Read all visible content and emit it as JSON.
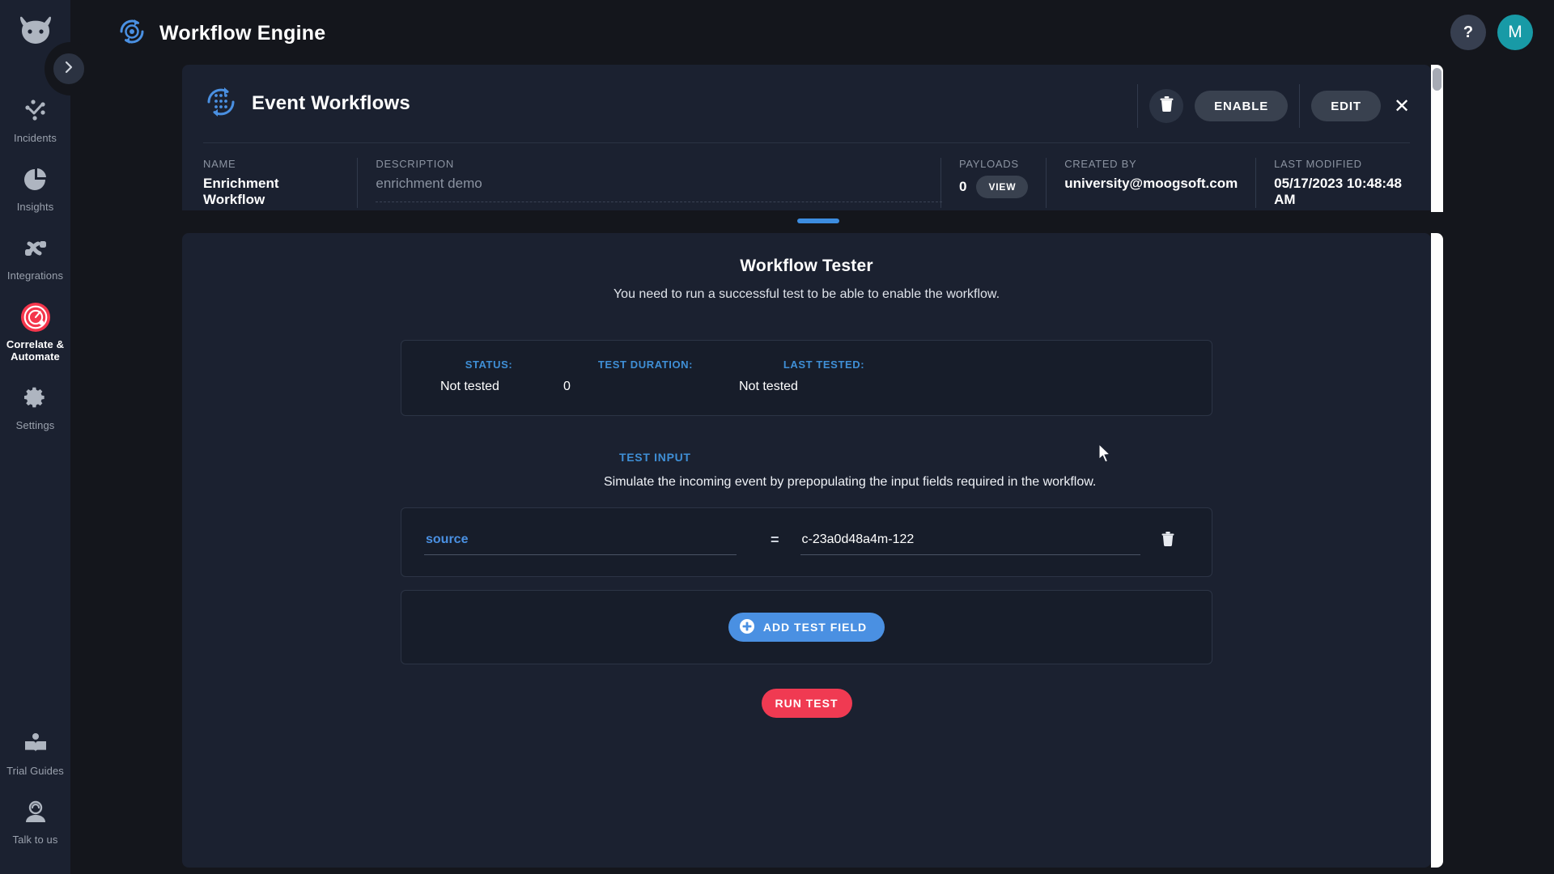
{
  "app": {
    "title": "Workflow Engine",
    "logo_icon": "workflow-engine-icon",
    "help_label": "?",
    "avatar_label": "M"
  },
  "sidebar": {
    "brand_icon": "moogsoft-bull-logo",
    "expand_icon": "chevron-right-icon",
    "items": [
      {
        "label": "Incidents",
        "icon": "incidents-icon",
        "active": false
      },
      {
        "label": "Insights",
        "icon": "pie-chart-icon",
        "active": false
      },
      {
        "label": "Integrations",
        "icon": "integrations-icon",
        "active": false
      },
      {
        "label": "Correlate & Automate",
        "icon": "target-icon",
        "active": true
      },
      {
        "label": "Settings",
        "icon": "gear-icon",
        "active": false
      }
    ],
    "bottom_items": [
      {
        "label": "Trial Guides",
        "icon": "book-icon"
      },
      {
        "label": "Talk to us",
        "icon": "support-agent-icon"
      }
    ]
  },
  "detail_panel": {
    "icon": "event-workflows-icon",
    "title": "Event Workflows",
    "actions": {
      "delete_icon": "trash-icon",
      "enable_label": "ENABLE",
      "edit_label": "EDIT",
      "close_icon": "close-icon"
    },
    "meta": {
      "name_label": "NAME",
      "name_value": "Enrichment Workflow",
      "description_label": "DESCRIPTION",
      "description_value": "enrichment demo",
      "payloads_label": "PAYLOADS",
      "payloads_count": "0",
      "payloads_view_label": "VIEW",
      "created_by_label": "CREATED BY",
      "created_by_value": "university@moogsoft.com",
      "last_modified_label": "LAST MODIFIED",
      "last_modified_value": "05/17/2023 10:48:48 AM"
    }
  },
  "tester": {
    "title": "Workflow Tester",
    "subtitle": "You need to run a successful test to be able to enable the workflow.",
    "status": {
      "status_label": "STATUS:",
      "status_value": "Not tested",
      "duration_label": "TEST DURATION:",
      "duration_value": "0",
      "last_tested_label": "LAST TESTED:",
      "last_tested_value": "Not tested"
    },
    "test_input_label": "TEST INPUT",
    "test_input_desc": "Simulate the incoming event by prepopulating the input fields required in the workflow.",
    "fields": [
      {
        "key": "source",
        "key_placeholder": "key",
        "equals": "=",
        "value": "c-23a0d48a4m-122",
        "value_placeholder": "value",
        "delete_icon": "trash-icon"
      }
    ],
    "add_field_label": "ADD TEST FIELD",
    "add_field_icon": "plus-circle-icon",
    "run_test_label": "RUN TEST"
  },
  "colors": {
    "accent_blue": "#4a90e2",
    "accent_red": "#f03a52",
    "panel_bg": "#1b2130",
    "page_bg": "#14161c",
    "avatar_teal": "#189aa6"
  }
}
